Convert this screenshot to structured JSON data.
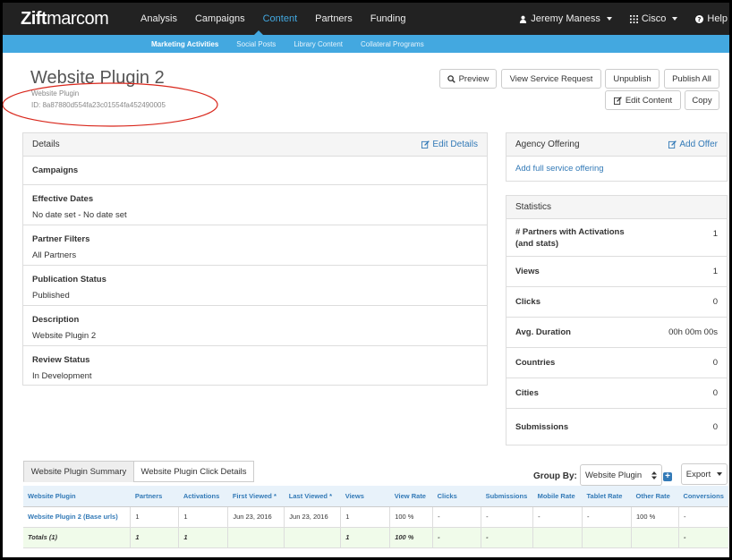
{
  "nav": {
    "logo_bold": "Zift",
    "logo_light": "marcom",
    "items": [
      "Analysis",
      "Campaigns",
      "Content",
      "Partners",
      "Funding"
    ],
    "user": "Jeremy Maness",
    "org": "Cisco",
    "help": "Help"
  },
  "subnav": {
    "items": [
      "Marketing Activities",
      "Social Posts",
      "Library Content",
      "Collateral Programs"
    ]
  },
  "header": {
    "title": "Website Plugin 2",
    "subtitle": "Website Plugin",
    "id": "ID: 8a87880d554fa23c01554fa452490005"
  },
  "buttons": {
    "preview": "Preview",
    "view_service_request": "View Service Request",
    "unpublish": "Unpublish",
    "publish_all": "Publish All",
    "edit_content": "Edit Content",
    "copy": "Copy"
  },
  "details": {
    "title": "Details",
    "edit_link": "Edit Details",
    "rows": [
      {
        "label": "Campaigns",
        "value": ""
      },
      {
        "label": "Effective Dates",
        "value": "No date set - No date set"
      },
      {
        "label": "Partner Filters",
        "value": "All Partners"
      },
      {
        "label": "Publication Status",
        "value": "Published"
      },
      {
        "label": "Description",
        "value": "Website Plugin 2"
      },
      {
        "label": "Review Status",
        "value": "In Development"
      }
    ]
  },
  "agency": {
    "title": "Agency Offering",
    "add_link": "Add Offer",
    "body_link": "Add full service offering"
  },
  "statistics": {
    "title": "Statistics",
    "rows": [
      {
        "label": "# Partners with Activations (and stats)",
        "value": "1"
      },
      {
        "label": "Views",
        "value": "1"
      },
      {
        "label": "Clicks",
        "value": "0"
      },
      {
        "label": "Avg. Duration",
        "value": "00h 00m 00s"
      },
      {
        "label": "Countries",
        "value": "0"
      },
      {
        "label": "Cities",
        "value": "0"
      },
      {
        "label": "Submissions",
        "value": "0"
      }
    ]
  },
  "tabs": [
    "Website Plugin Summary",
    "Website Plugin Click Details"
  ],
  "toolbar": {
    "group_by_label": "Group By:",
    "group_by_value": "Website Plugin",
    "export_label": "Export"
  },
  "table": {
    "columns": [
      "Website Plugin",
      "Partners",
      "Activations",
      "First Viewed *",
      "Last Viewed *",
      "Views",
      "View Rate",
      "Clicks",
      "Submissions",
      "Mobile Rate",
      "Tablet Rate",
      "Other Rate",
      "Conversions"
    ],
    "rows": [
      [
        "Website Plugin 2  (Base urls)",
        "1",
        "1",
        "Jun 23, 2016",
        "Jun 23, 2016",
        "1",
        "100 %",
        "-",
        "-",
        "-",
        "-",
        "100 %",
        "-"
      ]
    ],
    "totals": [
      "Totals (1)",
      "1",
      "1",
      "",
      "",
      "1",
      "100 %",
      "-",
      "-",
      "",
      "",
      "",
      "-"
    ]
  },
  "colors": {
    "navbar": "#222222",
    "accent": "#43a8e0",
    "link": "#337ab7",
    "annotation": "#d9271c",
    "totals_bg": "#f0fbea"
  }
}
